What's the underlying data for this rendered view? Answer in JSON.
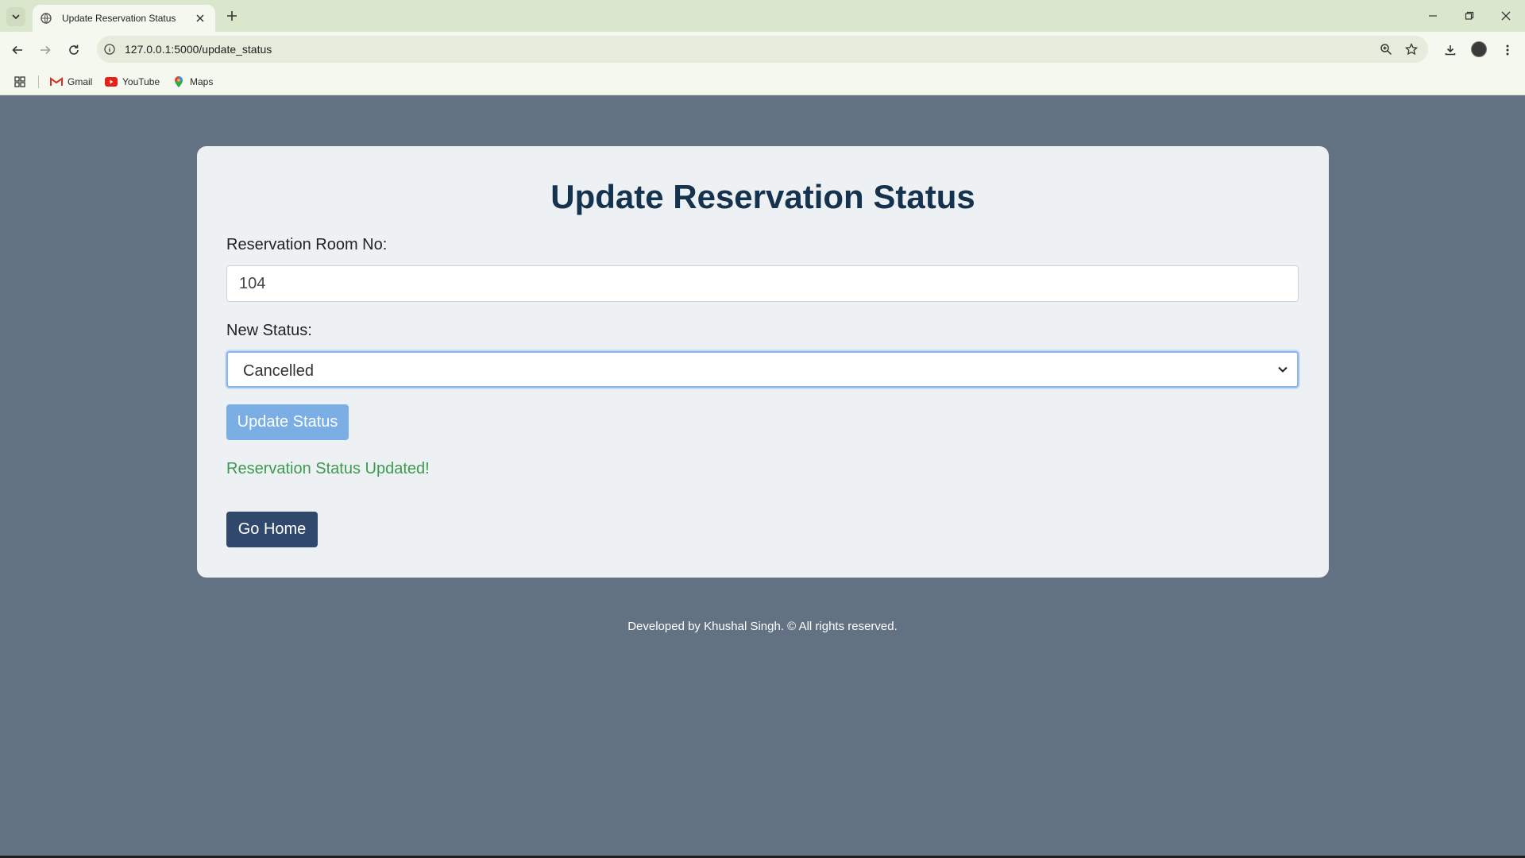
{
  "browser": {
    "tab_title": "Update Reservation Status",
    "url": "127.0.0.1:5000/update_status",
    "bookmarks": [
      {
        "label": "Gmail",
        "icon": "gmail-icon"
      },
      {
        "label": "YouTube",
        "icon": "youtube-icon"
      },
      {
        "label": "Maps",
        "icon": "maps-icon"
      }
    ]
  },
  "page": {
    "title": "Update Reservation Status",
    "room_label": "Reservation Room No:",
    "room_value": "104",
    "status_label": "New Status:",
    "status_value": "Cancelled",
    "update_button": "Update Status",
    "success_message": "Reservation Status Updated!",
    "home_button": "Go Home",
    "footer": "Developed by Khushal Singh. © All rights reserved."
  },
  "colors": {
    "page_background": "#637283",
    "card_background": "#eef1f3",
    "title": "#15324f",
    "update_button": "#7aaee4",
    "home_button": "#30486b",
    "success": "#3d9a50",
    "focus_ring": "#8ab4e8"
  }
}
